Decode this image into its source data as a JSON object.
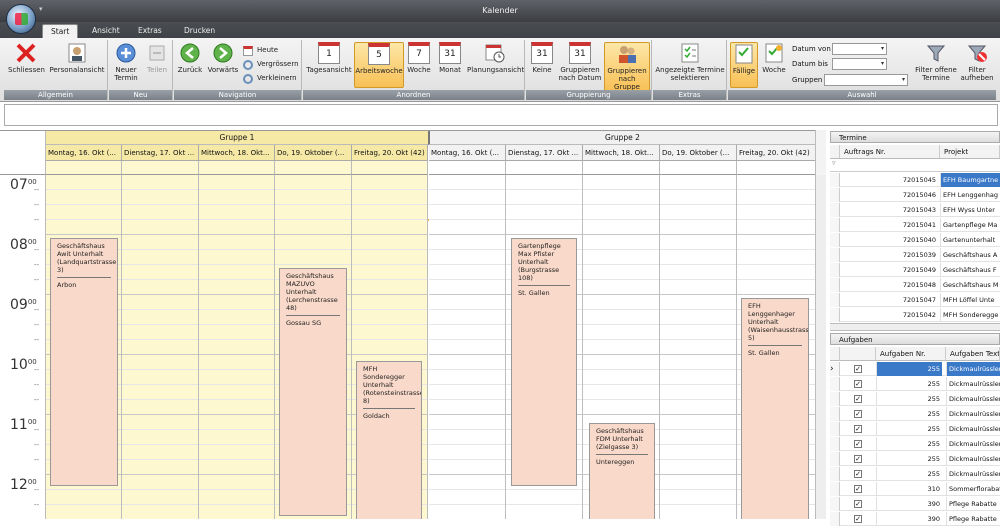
{
  "window": {
    "title": "Kalender",
    "quick_access": "▾"
  },
  "tabs": [
    "Start",
    "Ansicht",
    "Extras",
    "Drucken"
  ],
  "ribbon": {
    "groups": {
      "allgemein": "Allgemein",
      "neu": "Neu",
      "navigation": "Navigation",
      "anordnen": "Anordnen",
      "gruppierung": "Gruppierung",
      "extras": "Extras",
      "auswahl": "Auswahl"
    },
    "buttons": {
      "schliessen": "Schliessen",
      "personalansicht": "Personalansicht",
      "neuer_termin_1": "Neuer",
      "neuer_termin_2": "Termin",
      "teilen": "Teilen",
      "zurueck": "Zurück",
      "vorwaerts": "Vorwärts",
      "heute": "Heute",
      "vergroessern": "Vergrössern",
      "verkleinern": "Verkleinern",
      "tagesansicht": "Tagesansicht",
      "arbeitswoche": "Arbeitswoche",
      "woche": "Woche",
      "monat": "Monat",
      "planungsansicht": "Planungsansicht",
      "keine": "Keine",
      "gruppieren_datum_1": "Gruppieren",
      "gruppieren_datum_2": "nach Datum",
      "gruppieren_gruppe_1": "Gruppieren",
      "gruppieren_gruppe_2": "nach Gruppe",
      "angezeigte_1": "Angezeigte Termine",
      "angezeigte_2": "selektieren",
      "faellige": "Fällige",
      "woche2": "Woche",
      "datum_von": "Datum von",
      "datum_bis": "Datum bis",
      "gruppen": "Gruppen",
      "filter_offene_1": "Filter offene",
      "filter_offene_2": "Termine",
      "filter_aufheben_1": "Filter",
      "filter_aufheben_2": "aufheben"
    },
    "cal_icons": {
      "tag": "1",
      "arbeitswoche": "5",
      "woche": "7",
      "monat": "31",
      "keine": "31",
      "gruppieren_datum": "31"
    }
  },
  "calendar": {
    "groups": [
      "Gruppe 1",
      "Gruppe 2"
    ],
    "days_g1": [
      "Montag, 16. Okt (...",
      "Dienstag, 17. Okt ...",
      "Mittwoch, 18. Okt...",
      "Do, 19. Oktober (...",
      "Freitag, 20. Okt (42)"
    ],
    "days_g2": [
      "Montag, 16. Okt (...",
      "Dienstag, 17. Okt ...",
      "Mittwoch, 18. Okt...",
      "Do, 19. Oktober (...",
      "Freitag, 20. Okt (42)"
    ],
    "hours": [
      "07",
      "08",
      "09",
      "10",
      "11",
      "12"
    ],
    "minutes": "00",
    "tick": "--",
    "appointments": [
      {
        "text": "Geschäftshaus Awit Unterhalt (Landquartstrasse 3)",
        "loc": "Arbon"
      },
      {
        "text": "Geschäftshaus MAZUVO Unterhalt (Lerchenstrasse 48)",
        "loc": "Gossau SG"
      },
      {
        "text": "MFH Sonderegger Unterhalt (Rotensteinstrasse 8)",
        "loc": "Goldach"
      },
      {
        "text": "Gartenpflege Max Pfister Unterhalt (Burgstrasse 108)",
        "loc": "St. Gallen"
      },
      {
        "text": "Geschäftshaus FDM Unterhalt (Zielgasse 3)",
        "loc": "Untereggen"
      },
      {
        "text": "EFH Lenggenhager Unterhalt (Waisenhausstrasse 5)",
        "loc": "St. Gallen"
      }
    ]
  },
  "termine": {
    "title": "Termine",
    "columns": [
      "Auftrags Nr.",
      "Projekt"
    ],
    "rows": [
      {
        "nr": "72015045",
        "projekt": "EFH Baumgartne"
      },
      {
        "nr": "72015046",
        "projekt": "EFH Lenggenhag"
      },
      {
        "nr": "72015043",
        "projekt": "EFH Wyss Unter"
      },
      {
        "nr": "72015041",
        "projekt": "Gartenpflege Ma"
      },
      {
        "nr": "72015040",
        "projekt": "Gartenunterhalt"
      },
      {
        "nr": "72015039",
        "projekt": "Geschäftshaus A"
      },
      {
        "nr": "72015049",
        "projekt": "Geschäftshaus F"
      },
      {
        "nr": "72015048",
        "projekt": "Geschäftshaus M"
      },
      {
        "nr": "72015047",
        "projekt": "MFH Löffel Unte"
      },
      {
        "nr": "72015042",
        "projekt": "MFH Sonderegge"
      }
    ]
  },
  "aufgaben": {
    "title": "Aufgaben",
    "columns": [
      "Aufgaben Nr.",
      "Aufgaben Text"
    ],
    "rows": [
      {
        "nr": "255",
        "text": "Dickmaulrüssler"
      },
      {
        "nr": "255",
        "text": "Dickmaulrüssler"
      },
      {
        "nr": "255",
        "text": "Dickmaulrüssler"
      },
      {
        "nr": "255",
        "text": "Dickmaulrüssler"
      },
      {
        "nr": "255",
        "text": "Dickmaulrüssler"
      },
      {
        "nr": "255",
        "text": "Dickmaulrüssler"
      },
      {
        "nr": "255",
        "text": "Dickmaulrüssler"
      },
      {
        "nr": "255",
        "text": "Dickmaulrüssler"
      },
      {
        "nr": "310",
        "text": "Sommerflorabat"
      },
      {
        "nr": "390",
        "text": "Pflege Rabatte"
      },
      {
        "nr": "390",
        "text": "Pflege Rabatte"
      }
    ]
  },
  "colors": {
    "accent": "#f8c055",
    "group1_bg": "#fdf8d0",
    "group1_header": "#f6e9a6",
    "appt": "#f9d9c9",
    "now_line": "#f0b040",
    "selection": "#3a78c8"
  }
}
